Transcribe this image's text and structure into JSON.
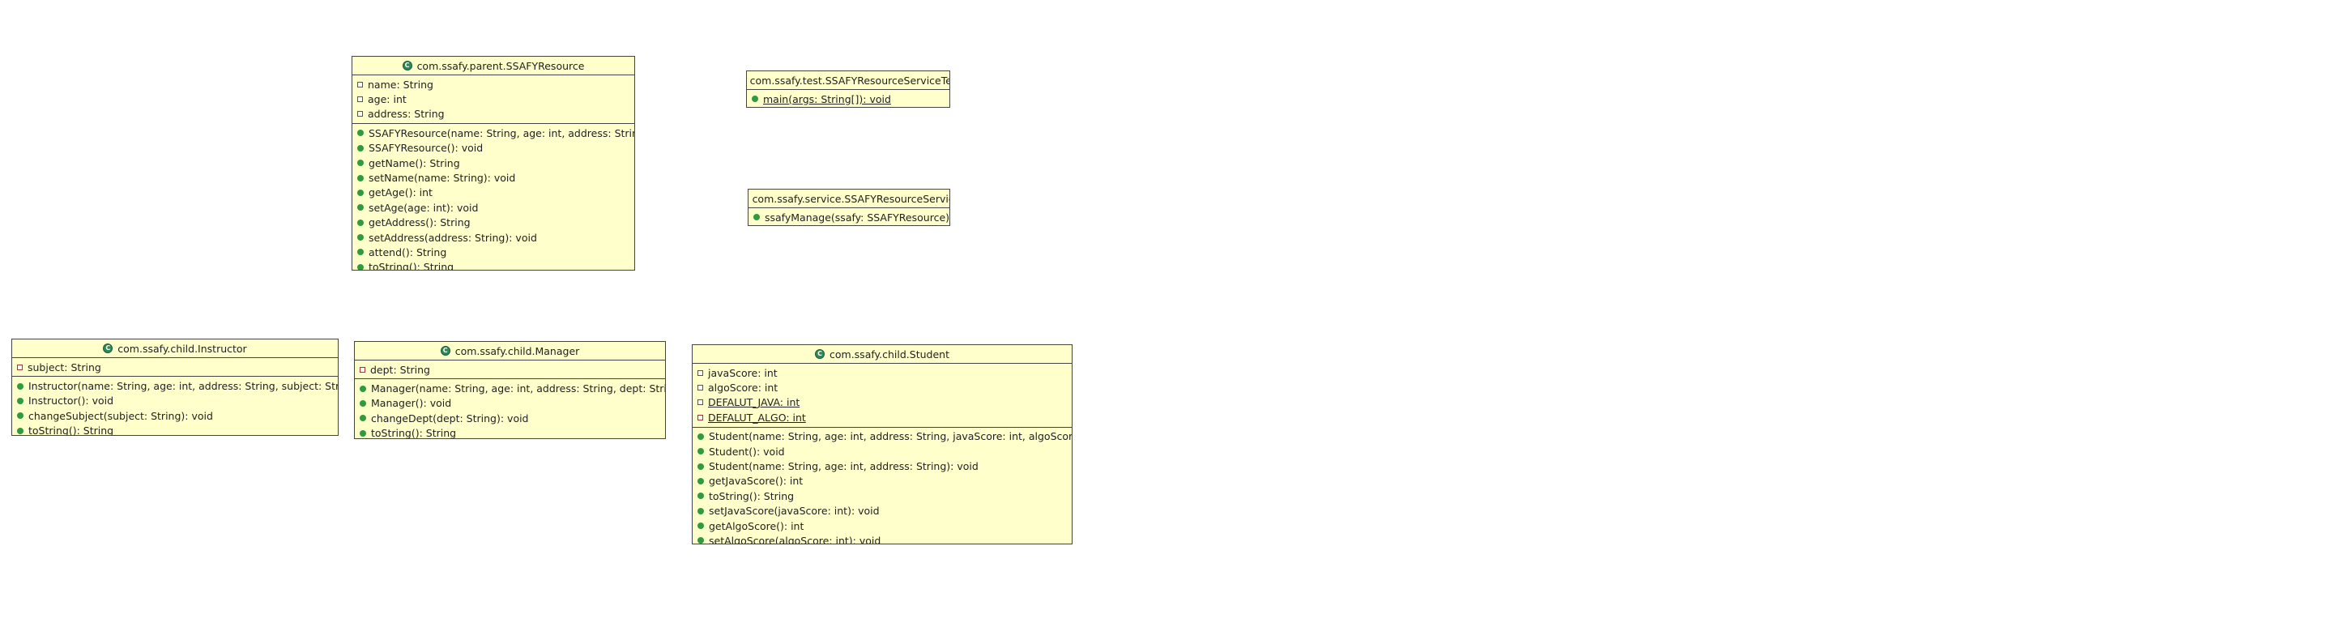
{
  "diagram": {
    "classes": [
      {
        "id": "ssafy-resource",
        "title": "com.ssafy.parent.SSAFYResource",
        "fields": [
          {
            "text": "name: String",
            "visibility": "private"
          },
          {
            "text": "age: int",
            "visibility": "private"
          },
          {
            "text": "address: String",
            "visibility": "private"
          }
        ],
        "methods": [
          {
            "text": "SSAFYResource(name: String, age: int, address: String): void",
            "visibility": "public"
          },
          {
            "text": "SSAFYResource(): void",
            "visibility": "public"
          },
          {
            "text": "getName(): String",
            "visibility": "public"
          },
          {
            "text": "setName(name: String): void",
            "visibility": "public"
          },
          {
            "text": "getAge(): int",
            "visibility": "public"
          },
          {
            "text": "setAge(age: int): void",
            "visibility": "public"
          },
          {
            "text": "getAddress(): String",
            "visibility": "public"
          },
          {
            "text": "setAddress(address: String): void",
            "visibility": "public"
          },
          {
            "text": "attend(): String",
            "visibility": "public"
          },
          {
            "text": "toString(): String",
            "visibility": "public"
          }
        ]
      },
      {
        "id": "ssafy-resource-service-test",
        "title": "com.ssafy.test.SSAFYResourceServiceTest",
        "fields": [],
        "methods": [
          {
            "text": "main(args: String[]): void",
            "visibility": "public",
            "static": true
          }
        ]
      },
      {
        "id": "ssafy-resource-service",
        "title": "com.ssafy.service.SSAFYResourceService",
        "fields": [],
        "methods": [
          {
            "text": "ssafyManage(ssafy: SSAFYResource): void",
            "visibility": "public"
          }
        ]
      },
      {
        "id": "instructor",
        "title": "com.ssafy.child.Instructor",
        "fields": [
          {
            "text": "subject: String",
            "visibility": "private"
          }
        ],
        "methods": [
          {
            "text": "Instructor(name: String, age: int, address: String, subject: String): void",
            "visibility": "public"
          },
          {
            "text": "Instructor(): void",
            "visibility": "public"
          },
          {
            "text": "changeSubject(subject: String): void",
            "visibility": "public"
          },
          {
            "text": "toString(): String",
            "visibility": "public"
          }
        ]
      },
      {
        "id": "manager",
        "title": "com.ssafy.child.Manager",
        "fields": [
          {
            "text": "dept: String",
            "visibility": "private"
          }
        ],
        "methods": [
          {
            "text": "Manager(name: String, age: int, address: String, dept: String): void",
            "visibility": "public"
          },
          {
            "text": "Manager(): void",
            "visibility": "public"
          },
          {
            "text": "changeDept(dept: String): void",
            "visibility": "public"
          },
          {
            "text": "toString(): String",
            "visibility": "public"
          }
        ]
      },
      {
        "id": "student",
        "title": "com.ssafy.child.Student",
        "fields": [
          {
            "text": "javaScore: int",
            "visibility": "private"
          },
          {
            "text": "algoScore: int",
            "visibility": "private"
          },
          {
            "text": "DEFALUT_JAVA: int",
            "visibility": "private",
            "static": true
          },
          {
            "text": "DEFALUT_ALGO: int",
            "visibility": "private",
            "static": true
          }
        ],
        "methods": [
          {
            "text": "Student(name: String, age: int, address: String, javaScore: int, algoScore: int): void",
            "visibility": "public"
          },
          {
            "text": "Student(): void",
            "visibility": "public"
          },
          {
            "text": "Student(name: String, age: int, address: String): void",
            "visibility": "public"
          },
          {
            "text": "getJavaScore(): int",
            "visibility": "public"
          },
          {
            "text": "toString(): String",
            "visibility": "public"
          },
          {
            "text": "setJavaScore(javaScore: int): void",
            "visibility": "public"
          },
          {
            "text": "getAlgoScore(): int",
            "visibility": "public"
          },
          {
            "text": "setAlgoScore(algoScore: int): void",
            "visibility": "public"
          }
        ]
      }
    ]
  }
}
